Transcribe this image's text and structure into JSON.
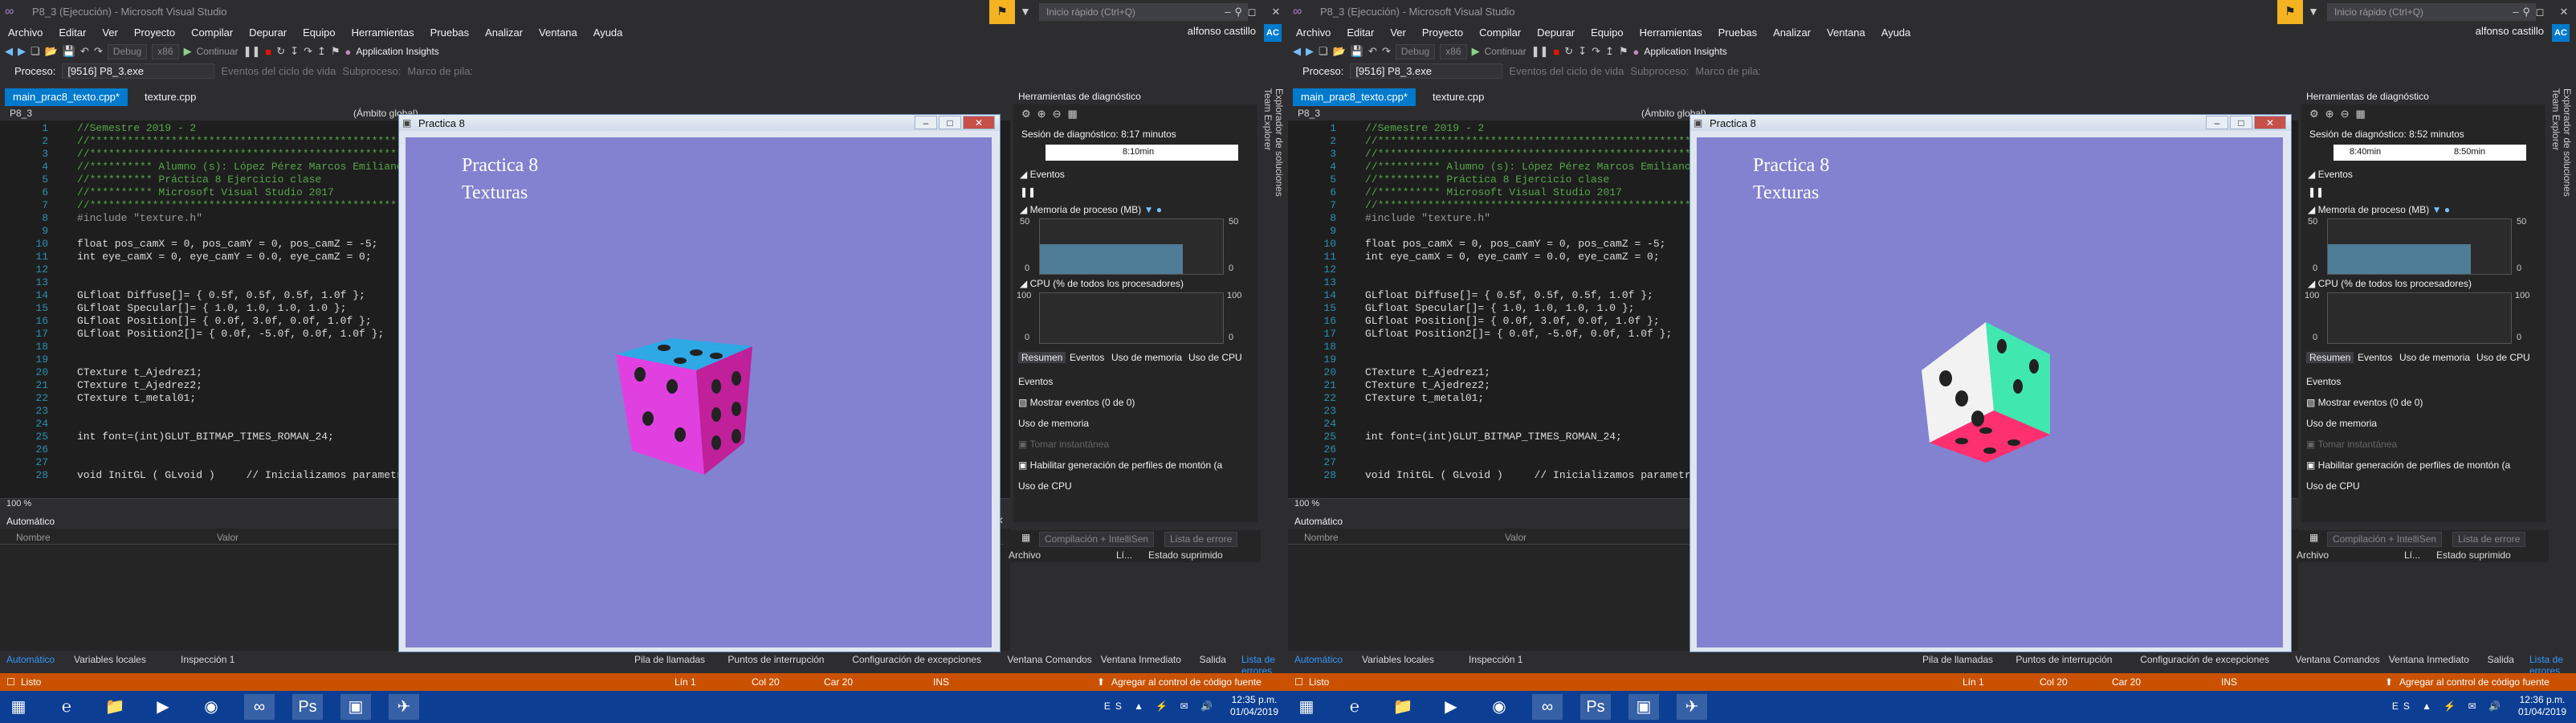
{
  "screens": [
    {
      "id": "left",
      "window_title": "P8_3 (Ejecución) - Microsoft Visual Studio",
      "quick_launch": "Inicio rápido (Ctrl+Q)",
      "user": "alfonso castillo",
      "avatar": "AC",
      "menu": [
        "Archivo",
        "Editar",
        "Ver",
        "Proyecto",
        "Compilar",
        "Depurar",
        "Equipo",
        "Herramientas",
        "Pruebas",
        "Analizar",
        "Ventana",
        "Ayuda"
      ],
      "toolbar": {
        "config": "Debug",
        "platform": "x86",
        "continue": "Continuar",
        "app_insights": "Application Insights"
      },
      "process_bar": {
        "label": "Proceso:",
        "process": "[9516] P8_3.exe",
        "lifecycle": "Eventos del ciclo de vida",
        "thread": "Subproceso:",
        "stack": "Marco de pila:"
      },
      "doc_tabs": [
        "main_prac8_texto.cpp*",
        "texture.cpp"
      ],
      "project_bar": {
        "project": "P8_3",
        "scope": "(Ámbito global)"
      },
      "code": [
        {
          "n": "1",
          "t": "//Semestre 2019 - 2",
          "c": "comment"
        },
        {
          "n": "2",
          "t": "//************************************************************//",
          "c": "comment"
        },
        {
          "n": "3",
          "t": "//************************************************************//",
          "c": "comment"
        },
        {
          "n": "4",
          "t": "//********** Alumno (s): López Pérez Marcos Emiliano ****",
          "c": "comment"
        },
        {
          "n": "5",
          "t": "//********** Práctica 8 Ejercicio clase",
          "c": "comment"
        },
        {
          "n": "6",
          "t": "//********** Microsoft Visual Studio 2017",
          "c": "comment"
        },
        {
          "n": "7",
          "t": "//************************************************************//",
          "c": "comment"
        },
        {
          "n": "8",
          "t": "#include \"texture.h\"",
          "c": "pp"
        },
        {
          "n": "9",
          "t": "",
          "c": "txt"
        },
        {
          "n": "10",
          "t": "float pos_camX = 0, pos_camY = 0, pos_camZ = -5;",
          "c": "txt"
        },
        {
          "n": "11",
          "t": "int eye_camX = 0, eye_camY = 0.0, eye_camZ = 0;",
          "c": "txt"
        },
        {
          "n": "12",
          "t": "",
          "c": "txt"
        },
        {
          "n": "13",
          "t": "",
          "c": "txt"
        },
        {
          "n": "14",
          "t": "GLfloat Diffuse[]= { 0.5f, 0.5f, 0.5f, 1.0f };",
          "c": "txt"
        },
        {
          "n": "15",
          "t": "GLfloat Specular[]= { 1.0, 1.0, 1.0, 1.0 };",
          "c": "txt"
        },
        {
          "n": "16",
          "t": "GLfloat Position[]= { 0.0f, 3.0f, 0.0f, 1.0f };",
          "c": "txt"
        },
        {
          "n": "17",
          "t": "GLfloat Position2[]= { 0.0f, -5.0f, 0.0f, 1.0f };",
          "c": "txt"
        },
        {
          "n": "18",
          "t": "",
          "c": "txt"
        },
        {
          "n": "19",
          "t": "",
          "c": "txt"
        },
        {
          "n": "20",
          "t": "CTexture t_Ajedrez1;",
          "c": "txt"
        },
        {
          "n": "21",
          "t": "CTexture t_Ajedrez2;",
          "c": "txt"
        },
        {
          "n": "22",
          "t": "CTexture t_metal01;",
          "c": "txt"
        },
        {
          "n": "23",
          "t": "",
          "c": "txt"
        },
        {
          "n": "24",
          "t": "",
          "c": "txt"
        },
        {
          "n": "25",
          "t": "int font=(int)GLUT_BITMAP_TIMES_ROMAN_24;",
          "c": "txt"
        },
        {
          "n": "26",
          "t": "",
          "c": "txt"
        },
        {
          "n": "27",
          "t": "",
          "c": "txt"
        },
        {
          "n": "28",
          "t": "void InitGL ( GLvoid )     // Inicializamos parametros",
          "c": "txt"
        }
      ],
      "zoom": "100 %",
      "auto_panel": {
        "title": "Automático",
        "col_name": "Nombre",
        "col_value": "Valor"
      },
      "diag": {
        "title": "Herramientas de diagnóstico",
        "session": "Sesión de diagnóstico: 8:17 minutos",
        "timeline_labels": [
          "8:10min"
        ],
        "events": "Eventos",
        "memory": "Memoria de proceso (MB)",
        "mem_max": "50",
        "mem_min": "0",
        "mem_level": 0.55,
        "cpu": "CPU (% de todos los procesadores)",
        "cpu_max": "100",
        "cpu_min": "0",
        "tabs": [
          "Resumen",
          "Eventos",
          "Uso de memoria",
          "Uso de CPU"
        ],
        "list": [
          "Eventos",
          "Mostrar eventos (0 de 0)",
          "Uso de memoria",
          "Tomar instantánea",
          "Habilitar generación de perfiles de montón (a",
          "Uso de CPU"
        ]
      },
      "vert_tabs": [
        "Explorador de soluciones",
        "Team Explorer"
      ],
      "errbar": {
        "filter": "Compilación + IntelliSen",
        "search": "Lista de errore",
        "c1": "Archivo",
        "c2": "Lí...",
        "c3": "Estado suprimido"
      },
      "bottom_tabs_left": [
        "Automático",
        "Variables locales",
        "Inspección 1"
      ],
      "bottom_tabs_right": [
        "Pila de llamadas",
        "Puntos de interrupción",
        "Configuración de excepciones",
        "Ventana Comandos",
        "Ventana Inmediato",
        "Salida",
        "Lista de errores"
      ],
      "status": {
        "ready": "Listo",
        "line": "Lín 1",
        "col": "Col 20",
        "car": "Car 20",
        "ins": "INS",
        "source": "Agregar al control de código fuente"
      },
      "app": {
        "title": "Practica 8",
        "line1": "Practica 8",
        "line2": "Texturas"
      },
      "clock": {
        "time": "12:35 p.m.",
        "date": "01/04/2019"
      },
      "lang": "ES"
    },
    {
      "id": "right",
      "window_title": "P8_3 (Ejecución) - Microsoft Visual Studio",
      "quick_launch": "Inicio rápido (Ctrl+Q)",
      "user": "alfonso castillo",
      "avatar": "AC",
      "menu": [
        "Archivo",
        "Editar",
        "Ver",
        "Proyecto",
        "Compilar",
        "Depurar",
        "Equipo",
        "Herramientas",
        "Pruebas",
        "Analizar",
        "Ventana",
        "Ayuda"
      ],
      "toolbar": {
        "config": "Debug",
        "platform": "x86",
        "continue": "Continuar",
        "app_insights": "Application Insights"
      },
      "process_bar": {
        "label": "Proceso:",
        "process": "[9516] P8_3.exe",
        "lifecycle": "Eventos del ciclo de vida",
        "thread": "Subproceso:",
        "stack": "Marco de pila:"
      },
      "doc_tabs": [
        "main_prac8_texto.cpp*",
        "texture.cpp"
      ],
      "project_bar": {
        "project": "P8_3",
        "scope": "(Ámbito global)"
      },
      "code": [
        {
          "n": "1",
          "t": "//Semestre 2019 - 2",
          "c": "comment"
        },
        {
          "n": "2",
          "t": "//************************************************************//",
          "c": "comment"
        },
        {
          "n": "3",
          "t": "//************************************************************//",
          "c": "comment"
        },
        {
          "n": "4",
          "t": "//********** Alumno (s): López Pérez Marcos Emiliano ****",
          "c": "comment"
        },
        {
          "n": "5",
          "t": "//********** Práctica 8 Ejercicio clase",
          "c": "comment"
        },
        {
          "n": "6",
          "t": "//********** Microsoft Visual Studio 2017",
          "c": "comment"
        },
        {
          "n": "7",
          "t": "//************************************************************//",
          "c": "comment"
        },
        {
          "n": "8",
          "t": "#include \"texture.h\"",
          "c": "pp"
        },
        {
          "n": "9",
          "t": "",
          "c": "txt"
        },
        {
          "n": "10",
          "t": "float pos_camX = 0, pos_camY = 0, pos_camZ = -5;",
          "c": "txt"
        },
        {
          "n": "11",
          "t": "int eye_camX = 0, eye_camY = 0.0, eye_camZ = 0;",
          "c": "txt"
        },
        {
          "n": "12",
          "t": "",
          "c": "txt"
        },
        {
          "n": "13",
          "t": "",
          "c": "txt"
        },
        {
          "n": "14",
          "t": "GLfloat Diffuse[]= { 0.5f, 0.5f, 0.5f, 1.0f };",
          "c": "txt"
        },
        {
          "n": "15",
          "t": "GLfloat Specular[]= { 1.0, 1.0, 1.0, 1.0 };",
          "c": "txt"
        },
        {
          "n": "16",
          "t": "GLfloat Position[]= { 0.0f, 3.0f, 0.0f, 1.0f };",
          "c": "txt"
        },
        {
          "n": "17",
          "t": "GLfloat Position2[]= { 0.0f, -5.0f, 0.0f, 1.0f };",
          "c": "txt"
        },
        {
          "n": "18",
          "t": "",
          "c": "txt"
        },
        {
          "n": "19",
          "t": "",
          "c": "txt"
        },
        {
          "n": "20",
          "t": "CTexture t_Ajedrez1;",
          "c": "txt"
        },
        {
          "n": "21",
          "t": "CTexture t_Ajedrez2;",
          "c": "txt"
        },
        {
          "n": "22",
          "t": "CTexture t_metal01;",
          "c": "txt"
        },
        {
          "n": "23",
          "t": "",
          "c": "txt"
        },
        {
          "n": "24",
          "t": "",
          "c": "txt"
        },
        {
          "n": "25",
          "t": "int font=(int)GLUT_BITMAP_TIMES_ROMAN_24;",
          "c": "txt"
        },
        {
          "n": "26",
          "t": "",
          "c": "txt"
        },
        {
          "n": "27",
          "t": "",
          "c": "txt"
        },
        {
          "n": "28",
          "t": "void InitGL ( GLvoid )     // Inicializamos parametros",
          "c": "txt"
        }
      ],
      "zoom": "100 %",
      "auto_panel": {
        "title": "Automático",
        "col_name": "Nombre",
        "col_value": "Valor"
      },
      "diag": {
        "title": "Herramientas de diagnóstico",
        "session": "Sesión de diagnóstico: 8:52 minutos",
        "timeline_labels": [
          "8:40min",
          "8:50min"
        ],
        "events": "Eventos",
        "memory": "Memoria de proceso (MB)",
        "mem_max": "50",
        "mem_min": "0",
        "mem_level": 0.55,
        "cpu": "CPU (% de todos los procesadores)",
        "cpu_max": "100",
        "cpu_min": "0",
        "tabs": [
          "Resumen",
          "Eventos",
          "Uso de memoria",
          "Uso de CPU"
        ],
        "list": [
          "Eventos",
          "Mostrar eventos (0 de 0)",
          "Uso de memoria",
          "Tomar instantánea",
          "Habilitar generación de perfiles de montón (a",
          "Uso de CPU"
        ]
      },
      "vert_tabs": [
        "Explorador de soluciones",
        "Team Explorer"
      ],
      "errbar": {
        "filter": "Compilación + IntelliSen",
        "search": "Lista de errore",
        "c1": "Archivo",
        "c2": "Lí...",
        "c3": "Estado suprimido"
      },
      "bottom_tabs_left": [
        "Automático",
        "Variables locales",
        "Inspección 1"
      ],
      "bottom_tabs_right": [
        "Pila de llamadas",
        "Puntos de interrupción",
        "Configuración de excepciones",
        "Ventana Comandos",
        "Ventana Inmediato",
        "Salida",
        "Lista de errores"
      ],
      "status": {
        "ready": "Listo",
        "line": "Lín 1",
        "col": "Col 20",
        "car": "Car 20",
        "ins": "INS",
        "source": "Agregar al control de código fuente"
      },
      "app": {
        "title": "Practica 8",
        "line1": "Practica 8",
        "line2": "Texturas"
      },
      "clock": {
        "time": "12:36 p.m.",
        "date": "01/04/2019"
      },
      "lang": "ES"
    }
  ],
  "colors": {
    "vs_bg": "#2d2d30",
    "accent": "#007acc",
    "status": "#ca5100",
    "taskbar": "#0c3f93",
    "gl_bg": "#8282d0"
  },
  "icons": [
    "vs-logo-icon",
    "notification-flag-icon",
    "filter-icon",
    "search-icon",
    "windows-start-icon",
    "edge-icon",
    "explorer-folder-icon",
    "media-player-icon",
    "chrome-icon",
    "visual-studio-icon",
    "photoshop-icon",
    "app-icon",
    "plane-icon"
  ]
}
